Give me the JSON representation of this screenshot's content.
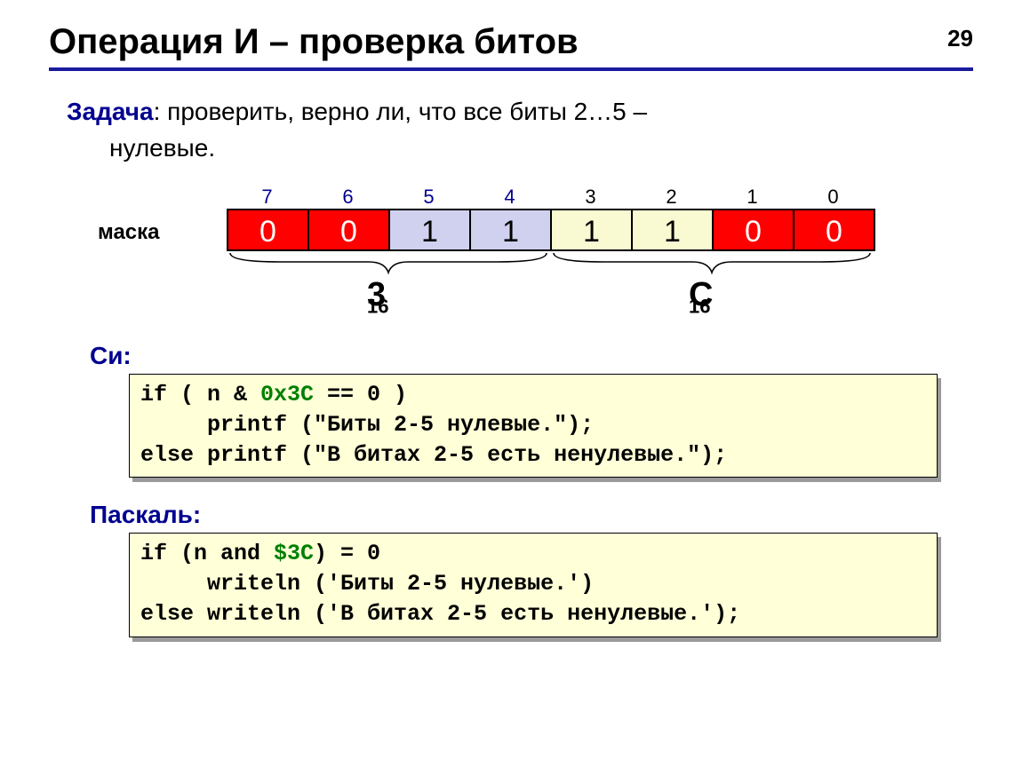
{
  "page_number": "29",
  "title": "Операция И – проверка битов",
  "task_label": "Задача",
  "task_text_1": ": проверить, верно ли, что все биты 2…5 –",
  "task_text_2": "нулевые.",
  "mask_label": "маска",
  "bit_indices": [
    "7",
    "6",
    "5",
    "4",
    "3",
    "2",
    "1",
    "0"
  ],
  "bit_values": [
    "0",
    "0",
    "1",
    "1",
    "1",
    "1",
    "0",
    "0"
  ],
  "hex_left": {
    "main": "3",
    "sub": "16"
  },
  "hex_right": {
    "main": "C",
    "sub": "16"
  },
  "lang_c": "Си:",
  "code_c_l1a": "if ( n & ",
  "code_c_l1b": "0x3C",
  "code_c_l1c": " == 0 )",
  "code_c_l2": "     printf (\"Биты 2-5 нулевые.\");",
  "code_c_l3": "else printf (\"В битах 2-5 есть ненулевые.\");",
  "lang_p": "Паскаль:",
  "code_p_l1a": "if (n and ",
  "code_p_l1b": "$3C",
  "code_p_l1c": ") = 0",
  "code_p_l2": "     writeln ('Биты 2-5 нулевые.')",
  "code_p_l3": "else writeln ('В битах 2-5 есть ненулевые.');"
}
